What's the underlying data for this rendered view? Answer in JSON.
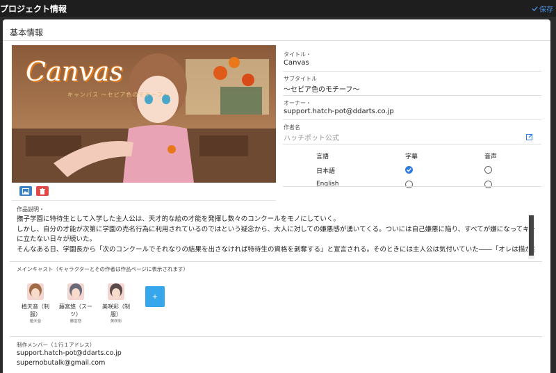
{
  "topbar": {
    "title": "プロジェクト情報",
    "save_label": "保存"
  },
  "section": {
    "title": "基本情報"
  },
  "hero": {
    "logo_text": "Canvas",
    "logo_sub": "キャンバス ～セピア色のモチーフ～"
  },
  "fields": {
    "title": {
      "label": "タイトル・",
      "value": "Canvas"
    },
    "subtitle": {
      "label": "サブタイトル",
      "value": "～セピア色のモチーフ～"
    },
    "owner": {
      "label": "オーナー・",
      "value": "support.hatch-pot@ddarts.co.jp"
    },
    "author": {
      "label": "作者名",
      "value": "ハッチポット公式"
    }
  },
  "languages": {
    "headers": [
      "言語",
      "字幕",
      "音声"
    ],
    "rows": [
      {
        "name": "日本語",
        "subtitle": true,
        "audio": false
      },
      {
        "name": "English",
        "subtitle": false,
        "audio": false
      }
    ]
  },
  "description": {
    "label": "作品説明・",
    "lines": [
      "撫子学園に特待生として入学した主人公は、天才的な絵の才能を発揮し数々のコンクールをモノにしていく。",
      "しかし、自分の才能が次第に学園の売名行為に利用されているのではという疑念から、大人に対しての嫌悪感が湧いてくる。ついには自己嫌悪に陥り、すべてが嫌になってキャンバスの前",
      "に立たない日々が続いた。",
      "そんなある日、学園長から「次のコンクールでそれなりの結果を出さなければ特待生の資格を剥奪する」と宣言される。そのときには主人公は気付いていた――「オレは描かないんじゃない、描けなくなっていたんだ……」"
    ]
  },
  "cast": {
    "label": "メインキャスト（キャラクターとその作者は作品ページに表示されます）",
    "add_label": "+",
    "items": [
      {
        "name": "植天音（制服）",
        "cv": "植天音"
      },
      {
        "name": "藤宮悠（スーツ）",
        "cv": "藤宮悠"
      },
      {
        "name": "美咲彩（制服）",
        "cv": "美咲彩"
      }
    ]
  },
  "members": {
    "label": "制作メンバー（１行１アドレス）",
    "items": [
      "support.hatch-pot@ddarts.co.jp",
      "supernobutalk@gmail.com"
    ]
  },
  "colors": {
    "accent": "#2f7de1",
    "danger": "#e04848",
    "add": "#35a7ea"
  }
}
